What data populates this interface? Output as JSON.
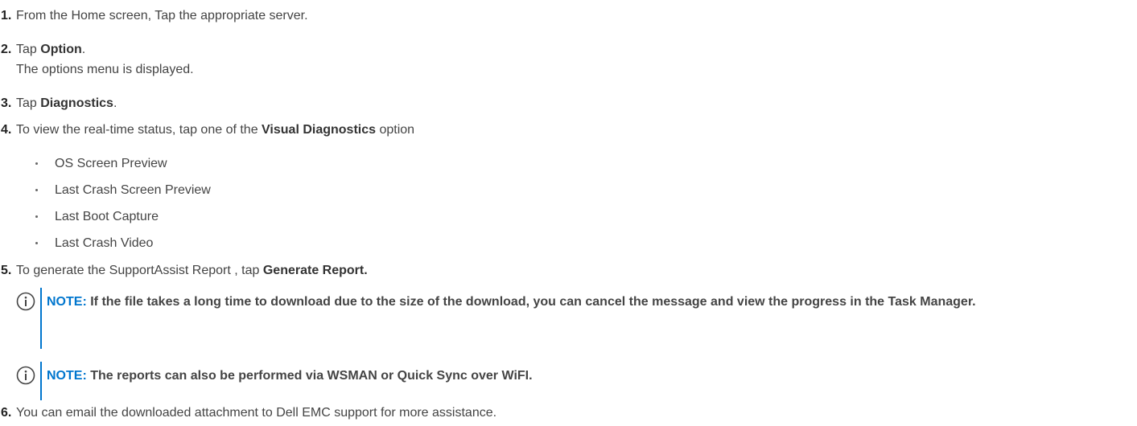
{
  "steps": [
    {
      "num": "1.",
      "text": "From the Home screen, Tap the appropriate server."
    },
    {
      "num": "2.",
      "pre": "Tap ",
      "bold": "Option",
      "post": ".",
      "sub": "The options menu is displayed."
    },
    {
      "num": "3.",
      "pre": "Tap ",
      "bold": "Diagnostics",
      "post": "."
    },
    {
      "num": "4.",
      "pre": "To view the real-time status, tap one of the ",
      "bold": "Visual Diagnostics",
      "post": " option"
    },
    {
      "num": "5.",
      "pre": "To generate the SupportAssist Report , tap ",
      "bold": "Generate Report.",
      "post": ""
    },
    {
      "num": "6.",
      "text": "You can email the downloaded attachment to Dell EMC support for more assistance."
    }
  ],
  "bullets": [
    "OS Screen Preview",
    "Last Crash Screen Preview",
    "Last Boot Capture",
    "Last Crash Video"
  ],
  "notes": [
    {
      "label": "NOTE:",
      "text": " If the file takes a long time to download due to the size of the download, you can cancel the message and view the progress in the Task Manager."
    },
    {
      "label": "NOTE:",
      "text": " The reports can also be performed via WSMAN or Quick Sync over WiFI."
    }
  ],
  "colors": {
    "accent": "#0076ce",
    "text": "#444444"
  },
  "icons": {
    "note": "info-circle-icon"
  }
}
